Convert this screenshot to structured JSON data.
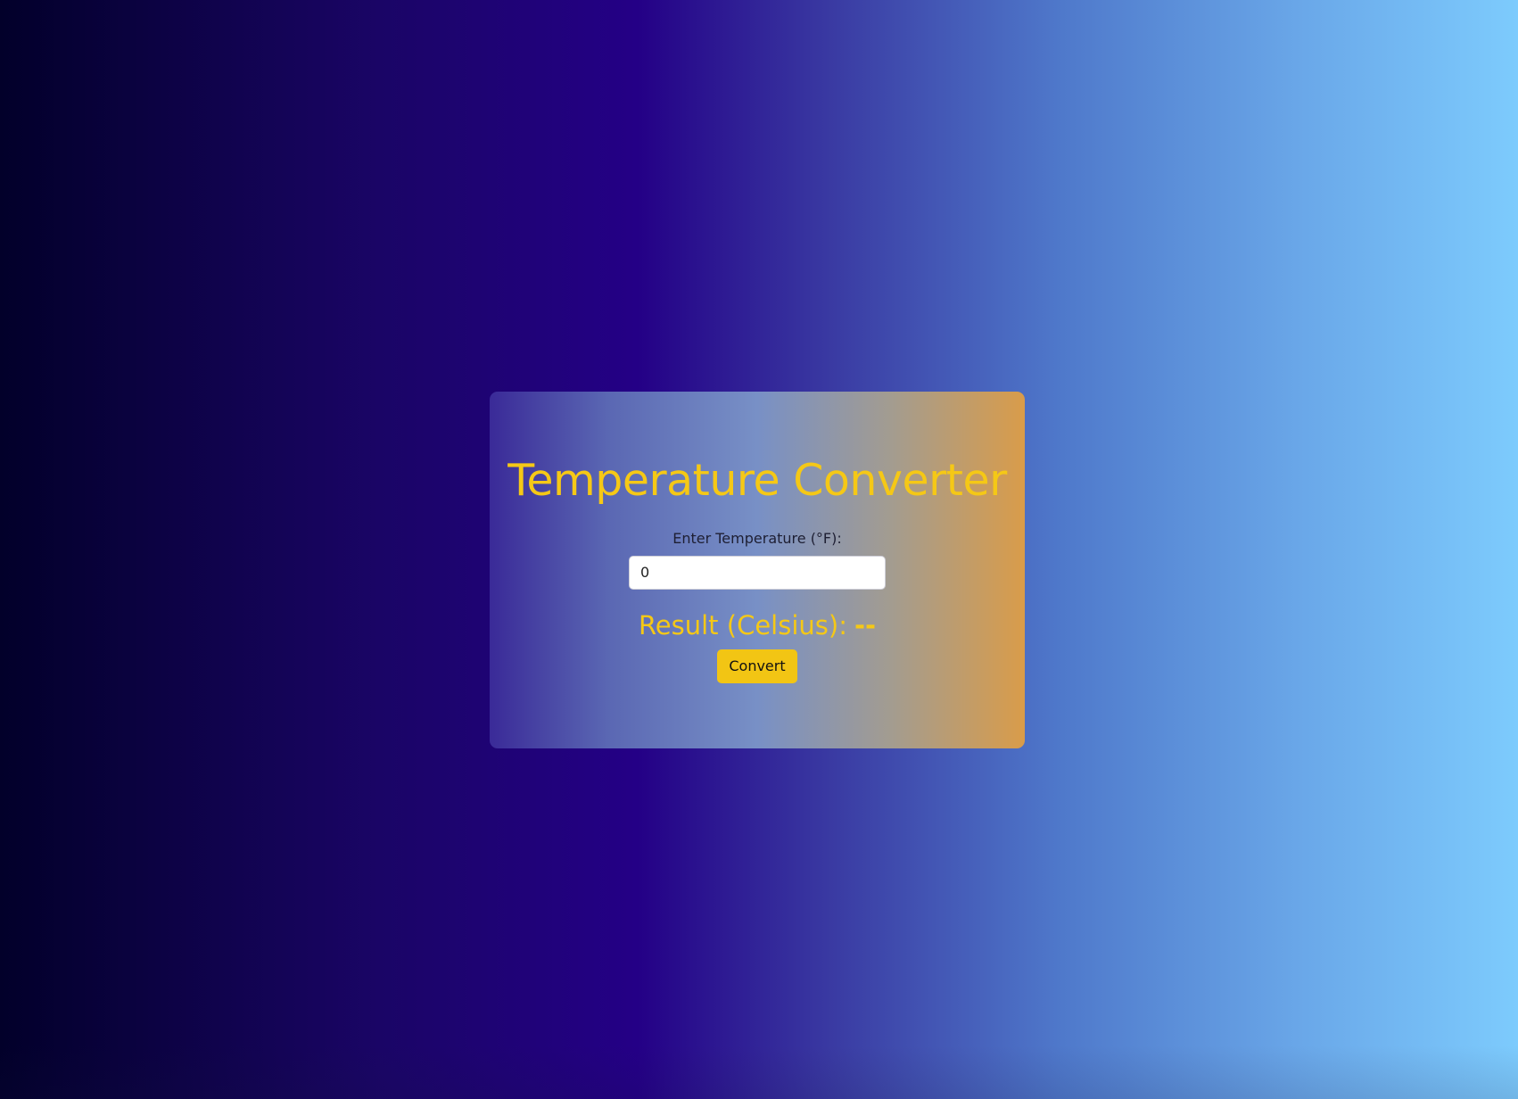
{
  "converter": {
    "title": "Temperature Converter",
    "input_label": "Enter Temperature (°F):",
    "input_value": "0",
    "result_label": "Result (Celsius):",
    "result_value": "--",
    "convert_label": "Convert"
  },
  "colors": {
    "accent": "#f5c816",
    "button": "#f2c514",
    "label_text": "#1e1f33"
  }
}
